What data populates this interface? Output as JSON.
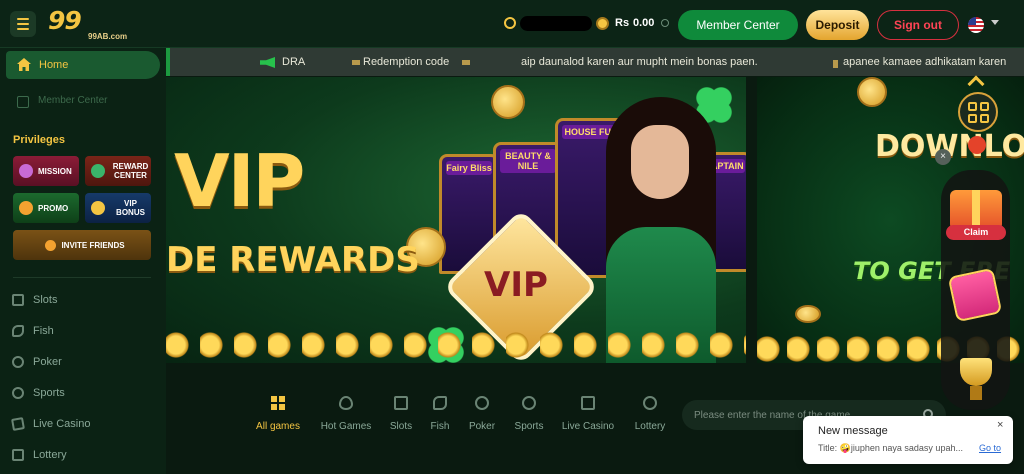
{
  "header": {
    "logo_text": "99",
    "logo_domain": "99AB.com",
    "currency": "Rs",
    "balance": "0.00",
    "member_center_label": "Member Center",
    "deposit_label": "Deposit",
    "signout_label": "Sign out"
  },
  "sidebar": {
    "home_label": "Home",
    "member_label": "Member Center",
    "privileges_title": "Privileges",
    "mission_label": "MISSION",
    "reward_label": "REWARD CENTER",
    "promo_label": "PROMO",
    "vip_label": "VIP BONUS",
    "invite_label": "INVITE FRIENDS",
    "games": [
      "Slots",
      "Fish",
      "Poker",
      "Sports",
      "Live Casino",
      "Lottery"
    ]
  },
  "ticker": {
    "items": [
      "DRA",
      "Redemption code",
      "aip daunalod karen aur mupht mein bonas paen.",
      "apanee kamaee adhikatam karen"
    ]
  },
  "banner": {
    "title": "VIP",
    "subtitle": "DE REWARDS",
    "badge": "VIP",
    "slot_tags": [
      "BEAUTY & NILE",
      "HOUSE FUN",
      "Fairy Bliss",
      "CAPTAIN"
    ]
  },
  "banner2": {
    "title": "DOWNLO",
    "subtitle": "TO GET FRE"
  },
  "floating": {
    "claim_label": "Claim",
    "close_glyph": "×"
  },
  "tabs": [
    "All games",
    "Hot Games",
    "Slots",
    "Fish",
    "Poker",
    "Sports",
    "Live Casino",
    "Lottery"
  ],
  "search": {
    "placeholder": "Please enter the name of the game"
  },
  "toast": {
    "title": "New message",
    "body": "Title: 🤪jiuphen naya sadasy upah...",
    "link": "Go to",
    "close": "×"
  },
  "colors": {
    "accent": "#f4c542",
    "brand_green": "#0f8a3b",
    "signout_red": "#d6303f"
  }
}
